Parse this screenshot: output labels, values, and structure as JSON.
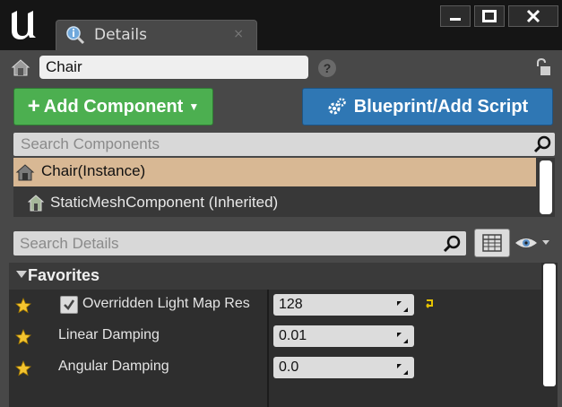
{
  "window": {
    "tab_title": "Details",
    "tab_close": "×"
  },
  "actor": {
    "name": "Chair",
    "help": "?"
  },
  "toolbar": {
    "add_component_label": "Add Component",
    "blueprint_label": "Blueprint/Add Script"
  },
  "components": {
    "search_placeholder": "Search Components",
    "items": [
      {
        "label": "Chair(Instance)",
        "selected": true
      },
      {
        "label": "StaticMeshComponent (Inherited)",
        "selected": false
      }
    ]
  },
  "details": {
    "search_placeholder": "Search Details",
    "category": "Favorites",
    "properties": [
      {
        "label": "Overridden Light Map Res",
        "value": "128",
        "has_checkbox": true,
        "checked": true,
        "has_reset": true
      },
      {
        "label": "Linear Damping",
        "value": "0.01",
        "has_checkbox": false
      },
      {
        "label": "Angular Damping",
        "value": "0.0",
        "has_checkbox": false
      }
    ]
  },
  "colors": {
    "add_component": "#4caf50",
    "blueprint": "#2f77b4",
    "selected_row": "#d8b894",
    "star": "#f4c430"
  }
}
